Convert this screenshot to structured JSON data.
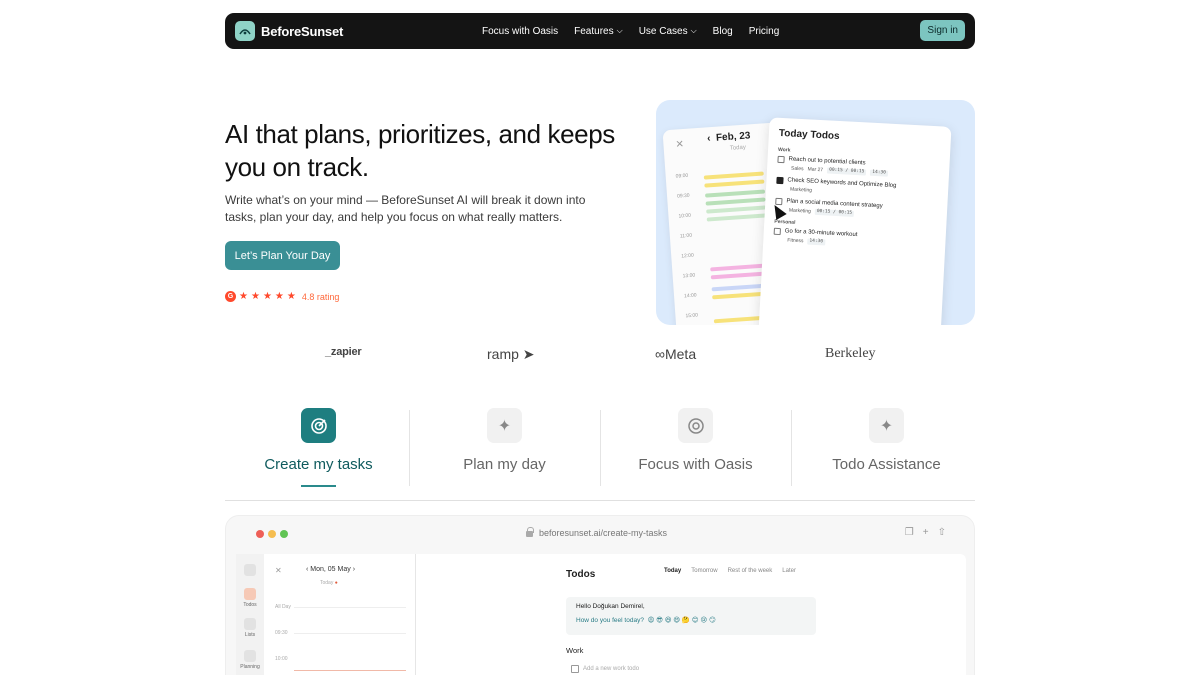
{
  "nav": {
    "brand": "BeforeSunset",
    "links": [
      {
        "label": "Focus with Oasis",
        "dropdown": false
      },
      {
        "label": "Features",
        "dropdown": true
      },
      {
        "label": "Use Cases",
        "dropdown": true
      },
      {
        "label": "Blog",
        "dropdown": false
      },
      {
        "label": "Pricing",
        "dropdown": false
      }
    ],
    "signin": "Sign in"
  },
  "hero": {
    "title": "AI that plans, prioritizes, and keeps you on track.",
    "subtitle": "Write what’s on your mind — BeforeSunset AI will break it down into tasks, plan your day, and help you focus on what really matters.",
    "cta": "Let’s Plan Your Day",
    "rating": "4.8 rating",
    "rating_badge": "G"
  },
  "hero_image": {
    "calendar": {
      "date": "Feb, 23",
      "today": "Today",
      "hours": [
        "09:00",
        "09:30",
        "10:00",
        "11:00",
        "12:00",
        "13:00",
        "14:00",
        "15:00"
      ]
    },
    "todo": {
      "title": "Today Todos",
      "sections": [
        {
          "name": "Work",
          "items": [
            {
              "text": "Reach out to potential clients",
              "tag": "Sales",
              "date": "Mar 27",
              "time": "00:15 / 00:15",
              "due": "14:30",
              "checked": false
            },
            {
              "text": "Check SEO keywords and Optimize Blog",
              "tag": "Marketing",
              "checked": true
            },
            {
              "text": "Plan a social media content strategy",
              "tag": "Marketing",
              "time": "00:15 / 00:15",
              "checked": false
            }
          ]
        },
        {
          "name": "Personal",
          "items": [
            {
              "text": "Go for a 30-minute workout",
              "tag": "Fitness",
              "due": "14:30",
              "checked": false
            }
          ]
        }
      ]
    }
  },
  "logos": [
    "zapier",
    "ramp",
    "Meta",
    "Berkeley"
  ],
  "features": {
    "tabs": [
      {
        "label": "Create my tasks",
        "icon": "target-icon",
        "active": true
      },
      {
        "label": "Plan my day",
        "icon": "sparkle-icon",
        "active": false
      },
      {
        "label": "Focus with Oasis",
        "icon": "focus-icon",
        "active": false
      },
      {
        "label": "Todo Assistance",
        "icon": "sparkle-icon",
        "active": false
      }
    ]
  },
  "browser": {
    "url": "beforesunset.ai/create-my-tasks",
    "sidebar": [
      "Todos",
      "Lists",
      "Planning"
    ],
    "calendar": {
      "date": "Mon, 05 May",
      "today": "Today",
      "allday": "All Day",
      "slots": [
        "09:30",
        "10:00"
      ]
    },
    "main": {
      "title": "Todos",
      "tabs": [
        "Today",
        "Tomorrow",
        "Rest of the week",
        "Later"
      ],
      "greeting": "Hello Doğukan Demirel,",
      "question": "How do you feel today?",
      "emojis": "😩 😎 😆 😄 🤔 😊 😢 😏",
      "section": "Work",
      "add_placeholder": "Add a new work todo"
    }
  },
  "colors": {
    "accent": "#3a8f95",
    "nav_bg": "#141414",
    "signin_bg": "#7cc5c0",
    "rating": "#ff492c"
  }
}
